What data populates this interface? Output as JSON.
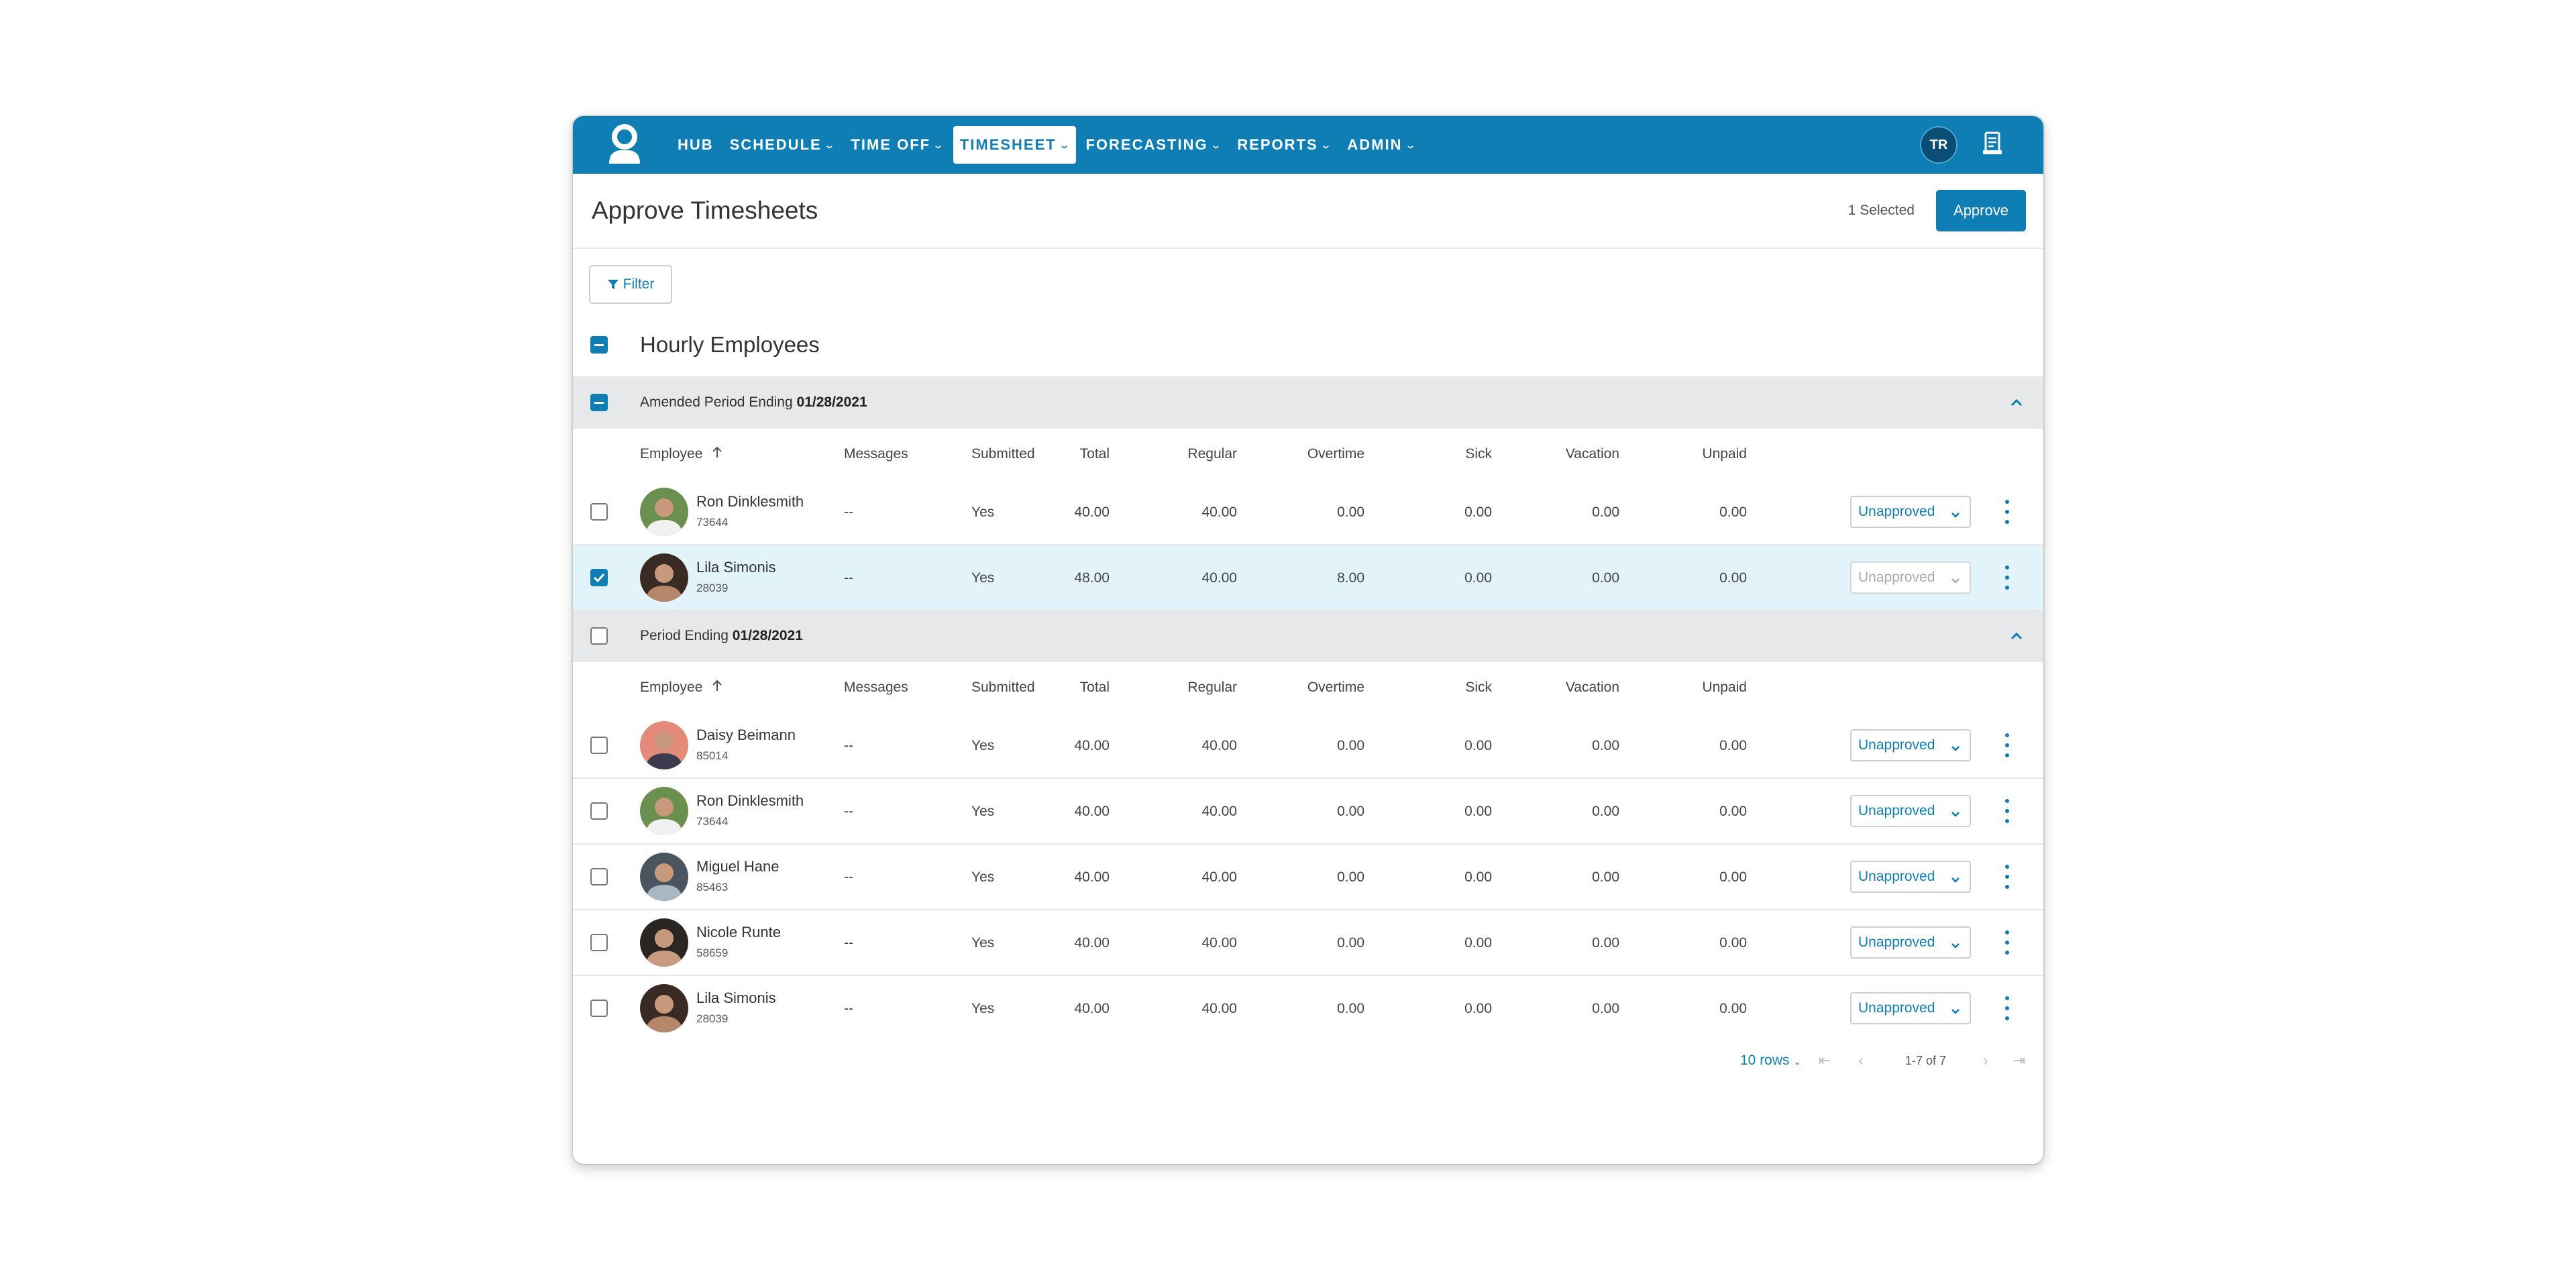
{
  "nav": {
    "items": [
      {
        "label": "HUB",
        "dropdown": false,
        "active": false
      },
      {
        "label": "SCHEDULE",
        "dropdown": true,
        "active": false
      },
      {
        "label": "TIME OFF",
        "dropdown": true,
        "active": false
      },
      {
        "label": "TIMESHEET",
        "dropdown": true,
        "active": true
      },
      {
        "label": "FORECASTING",
        "dropdown": true,
        "active": false
      },
      {
        "label": "REPORTS",
        "dropdown": true,
        "active": false
      },
      {
        "label": "ADMIN",
        "dropdown": true,
        "active": false
      }
    ],
    "user_initials": "TR"
  },
  "header": {
    "title": "Approve Timesheets",
    "selected_text": "1 Selected",
    "approve_label": "Approve"
  },
  "filter_label": "Filter",
  "group_title": "Hourly Employees",
  "columns": {
    "employee": "Employee",
    "messages": "Messages",
    "submitted": "Submitted",
    "total": "Total",
    "regular": "Regular",
    "overtime": "Overtime",
    "sick": "Sick",
    "vacation": "Vacation",
    "unpaid": "Unpaid"
  },
  "periods": [
    {
      "label_prefix": "Amended Period Ending",
      "date": "01/28/2021",
      "checkbox": "indeterminate",
      "rows": [
        {
          "name": "Ron Dinklesmith",
          "id": "73644",
          "messages": "--",
          "submitted": "Yes",
          "total": "40.00",
          "regular": "40.00",
          "overtime": "0.00",
          "sick": "0.00",
          "vacation": "0.00",
          "unpaid": "0.00",
          "status": "Unapproved",
          "checked": false
        },
        {
          "name": "Lila Simonis",
          "id": "28039",
          "messages": "--",
          "submitted": "Yes",
          "total": "48.00",
          "regular": "40.00",
          "overtime": "8.00",
          "sick": "0.00",
          "vacation": "0.00",
          "unpaid": "0.00",
          "status": "Unapproved",
          "checked": true
        }
      ]
    },
    {
      "label_prefix": "Period Ending",
      "date": "01/28/2021",
      "checkbox": "unchecked",
      "rows": [
        {
          "name": "Daisy Beimann",
          "id": "85014",
          "messages": "--",
          "submitted": "Yes",
          "total": "40.00",
          "regular": "40.00",
          "overtime": "0.00",
          "sick": "0.00",
          "vacation": "0.00",
          "unpaid": "0.00",
          "status": "Unapproved",
          "checked": false
        },
        {
          "name": "Ron Dinklesmith",
          "id": "73644",
          "messages": "--",
          "submitted": "Yes",
          "total": "40.00",
          "regular": "40.00",
          "overtime": "0.00",
          "sick": "0.00",
          "vacation": "0.00",
          "unpaid": "0.00",
          "status": "Unapproved",
          "checked": false
        },
        {
          "name": "Miguel Hane",
          "id": "85463",
          "messages": "--",
          "submitted": "Yes",
          "total": "40.00",
          "regular": "40.00",
          "overtime": "0.00",
          "sick": "0.00",
          "vacation": "0.00",
          "unpaid": "0.00",
          "status": "Unapproved",
          "checked": false
        },
        {
          "name": "Nicole Runte",
          "id": "58659",
          "messages": "--",
          "submitted": "Yes",
          "total": "40.00",
          "regular": "40.00",
          "overtime": "0.00",
          "sick": "0.00",
          "vacation": "0.00",
          "unpaid": "0.00",
          "status": "Unapproved",
          "checked": false
        },
        {
          "name": "Lila Simonis",
          "id": "28039",
          "messages": "--",
          "submitted": "Yes",
          "total": "40.00",
          "regular": "40.00",
          "overtime": "0.00",
          "sick": "0.00",
          "vacation": "0.00",
          "unpaid": "0.00",
          "status": "Unapproved",
          "checked": false
        }
      ]
    }
  ],
  "pagination": {
    "rows_label": "10 rows",
    "info": "1-7 of 7"
  },
  "colors": {
    "primary": "#0e7eb5",
    "selected_row": "#e2f3fa",
    "period_bg": "#e7e8ea"
  }
}
